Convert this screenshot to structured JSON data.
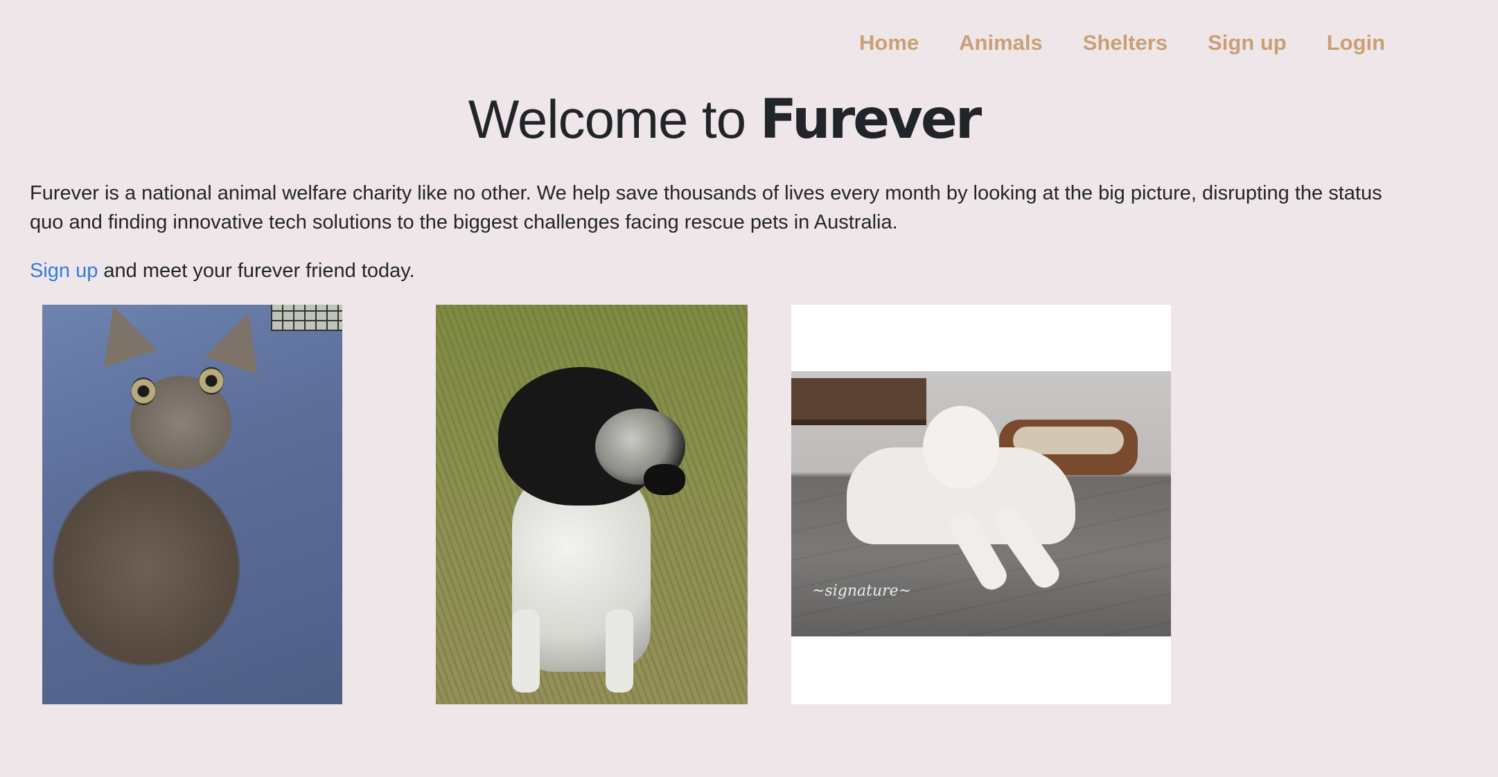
{
  "nav": {
    "items": [
      {
        "label": "Home"
      },
      {
        "label": "Animals"
      },
      {
        "label": "Shelters"
      },
      {
        "label": "Sign up"
      },
      {
        "label": "Login"
      }
    ]
  },
  "hero": {
    "title_prefix": "Welcome to ",
    "title_brand": "Furever"
  },
  "intro": {
    "text": "Furever is a national animal welfare charity like no other. We help save thousands of lives every month by looking at the big picture, disrupting the status quo and finding innovative tech solutions to the biggest challenges facing rescue pets in Australia."
  },
  "cta": {
    "link_label": "Sign up",
    "text": " and meet your furever friend today."
  },
  "photos": [
    {
      "subject": "tabby-kitten-photo"
    },
    {
      "subject": "black-white-dog-photo"
    },
    {
      "subject": "white-dog-photo"
    }
  ],
  "colors": {
    "background": "#efe6e9",
    "nav_link": "#c9a076",
    "link": "#2d7be5",
    "text": "#212529"
  }
}
